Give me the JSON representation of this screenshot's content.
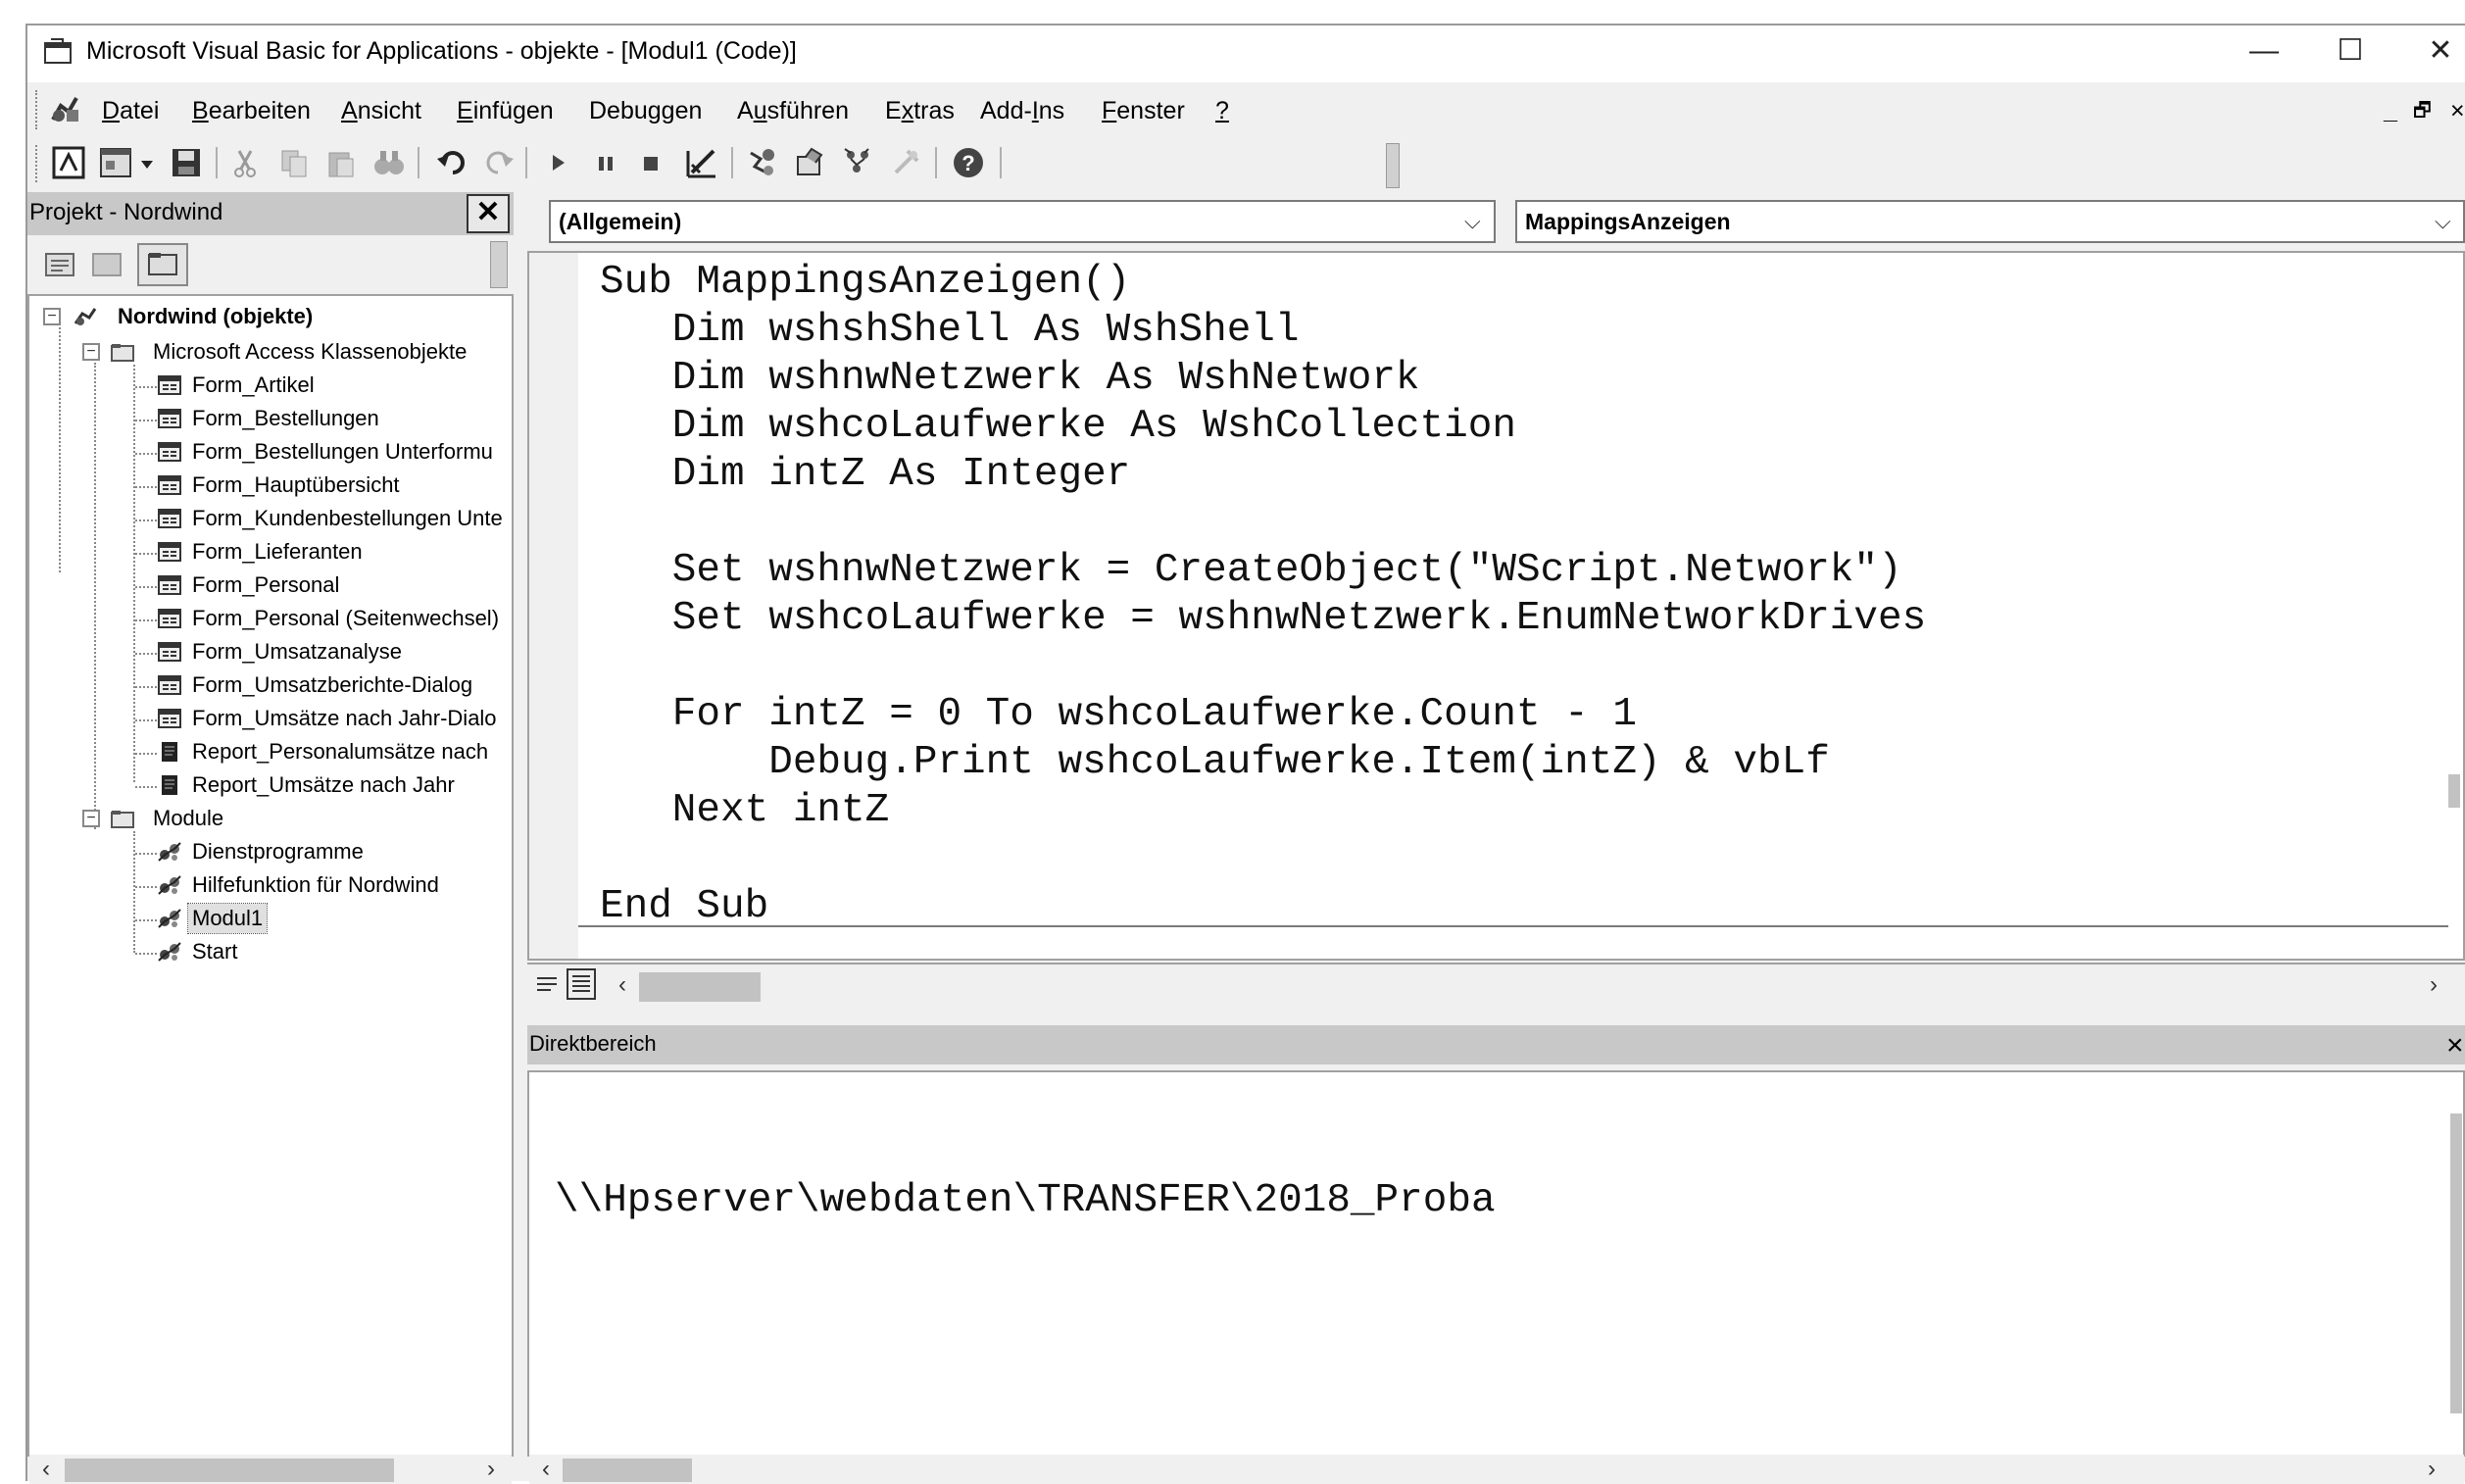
{
  "window": {
    "title": "Microsoft Visual Basic for Applications - objekte - [Modul1 (Code)]",
    "controls": {
      "minimize": "—",
      "maximize": "☐",
      "close": "✕"
    },
    "mdi_controls": {
      "minimize": "_",
      "restore": "🗗",
      "close": "×"
    }
  },
  "menu": {
    "items": [
      {
        "pre": "",
        "key": "D",
        "post": "atei"
      },
      {
        "pre": "",
        "key": "B",
        "post": "earbeiten"
      },
      {
        "pre": "",
        "key": "A",
        "post": "nsicht"
      },
      {
        "pre": "",
        "key": "E",
        "post": "infügen"
      },
      {
        "pre": "Debu",
        "key": "g",
        "post": "gen"
      },
      {
        "pre": "A",
        "key": "u",
        "post": "sführen"
      },
      {
        "pre": "E",
        "key": "x",
        "post": "tras"
      },
      {
        "pre": "Add-",
        "key": "I",
        "post": "ns"
      },
      {
        "pre": "",
        "key": "F",
        "post": "enster"
      },
      {
        "pre": "",
        "key": "?",
        "post": ""
      }
    ]
  },
  "toolbar": {
    "icons": [
      "view-access-icon",
      "insert-userform-icon",
      "dropdown-arrow-icon",
      "save-icon",
      "cut-icon",
      "copy-icon",
      "paste-icon",
      "find-icon",
      "undo-icon",
      "redo-icon",
      "run-icon",
      "break-icon",
      "reset-icon",
      "design-mode-icon",
      "project-explorer-icon",
      "properties-icon",
      "object-browser-icon",
      "toolbox-icon",
      "help-icon"
    ]
  },
  "project": {
    "title": "Projekt - Nordwind",
    "close": "✕",
    "root": "Nordwind (objekte)",
    "folders": [
      {
        "label": "Microsoft Access Klassenobjekte",
        "items": [
          {
            "label": "Form_Artikel",
            "type": "form"
          },
          {
            "label": "Form_Bestellungen",
            "type": "form"
          },
          {
            "label": "Form_Bestellungen Unterformu",
            "type": "form"
          },
          {
            "label": "Form_Hauptübersicht",
            "type": "form"
          },
          {
            "label": "Form_Kundenbestellungen Unte",
            "type": "form"
          },
          {
            "label": "Form_Lieferanten",
            "type": "form"
          },
          {
            "label": "Form_Personal",
            "type": "form"
          },
          {
            "label": "Form_Personal (Seitenwechsel)",
            "type": "form"
          },
          {
            "label": "Form_Umsatzanalyse",
            "type": "form"
          },
          {
            "label": "Form_Umsatzberichte-Dialog",
            "type": "form"
          },
          {
            "label": "Form_Umsätze nach Jahr-Dialo",
            "type": "form"
          },
          {
            "label": "Report_Personalumsätze nach",
            "type": "report"
          },
          {
            "label": "Report_Umsätze nach Jahr",
            "type": "report"
          }
        ]
      },
      {
        "label": "Module",
        "items": [
          {
            "label": "Dienstprogramme",
            "type": "module"
          },
          {
            "label": "Hilfefunktion für Nordwind",
            "type": "module"
          },
          {
            "label": "Modul1",
            "type": "module",
            "selected": true
          },
          {
            "label": "Start",
            "type": "module"
          }
        ]
      }
    ]
  },
  "code": {
    "object_combo": "(Allgemein)",
    "procedure_combo": "MappingsAnzeigen",
    "lines": [
      "Sub MappingsAnzeigen()",
      "   Dim wshshShell As WshShell",
      "   Dim wshnwNetzwerk As WshNetwork",
      "   Dim wshcoLaufwerke As WshCollection",
      "   Dim intZ As Integer",
      "",
      "   Set wshnwNetzwerk = CreateObject(\"WScript.Network\")",
      "   Set wshcoLaufwerke = wshnwNetzwerk.EnumNetworkDrives",
      "",
      "   For intZ = 0 To wshcoLaufwerke.Count - 1",
      "       Debug.Print wshcoLaufwerke.Item(intZ) & vbLf",
      "   Next intZ",
      "",
      "End Sub"
    ]
  },
  "immediate": {
    "title": "Direktbereich",
    "lines": [
      "\\\\Hpserver\\webdaten\\TRANSFER\\2018_Proba"
    ]
  },
  "colors": {
    "background": "#f0f0f0",
    "panel_header": "#c8c8c8",
    "selection": "#e0e0e0"
  }
}
